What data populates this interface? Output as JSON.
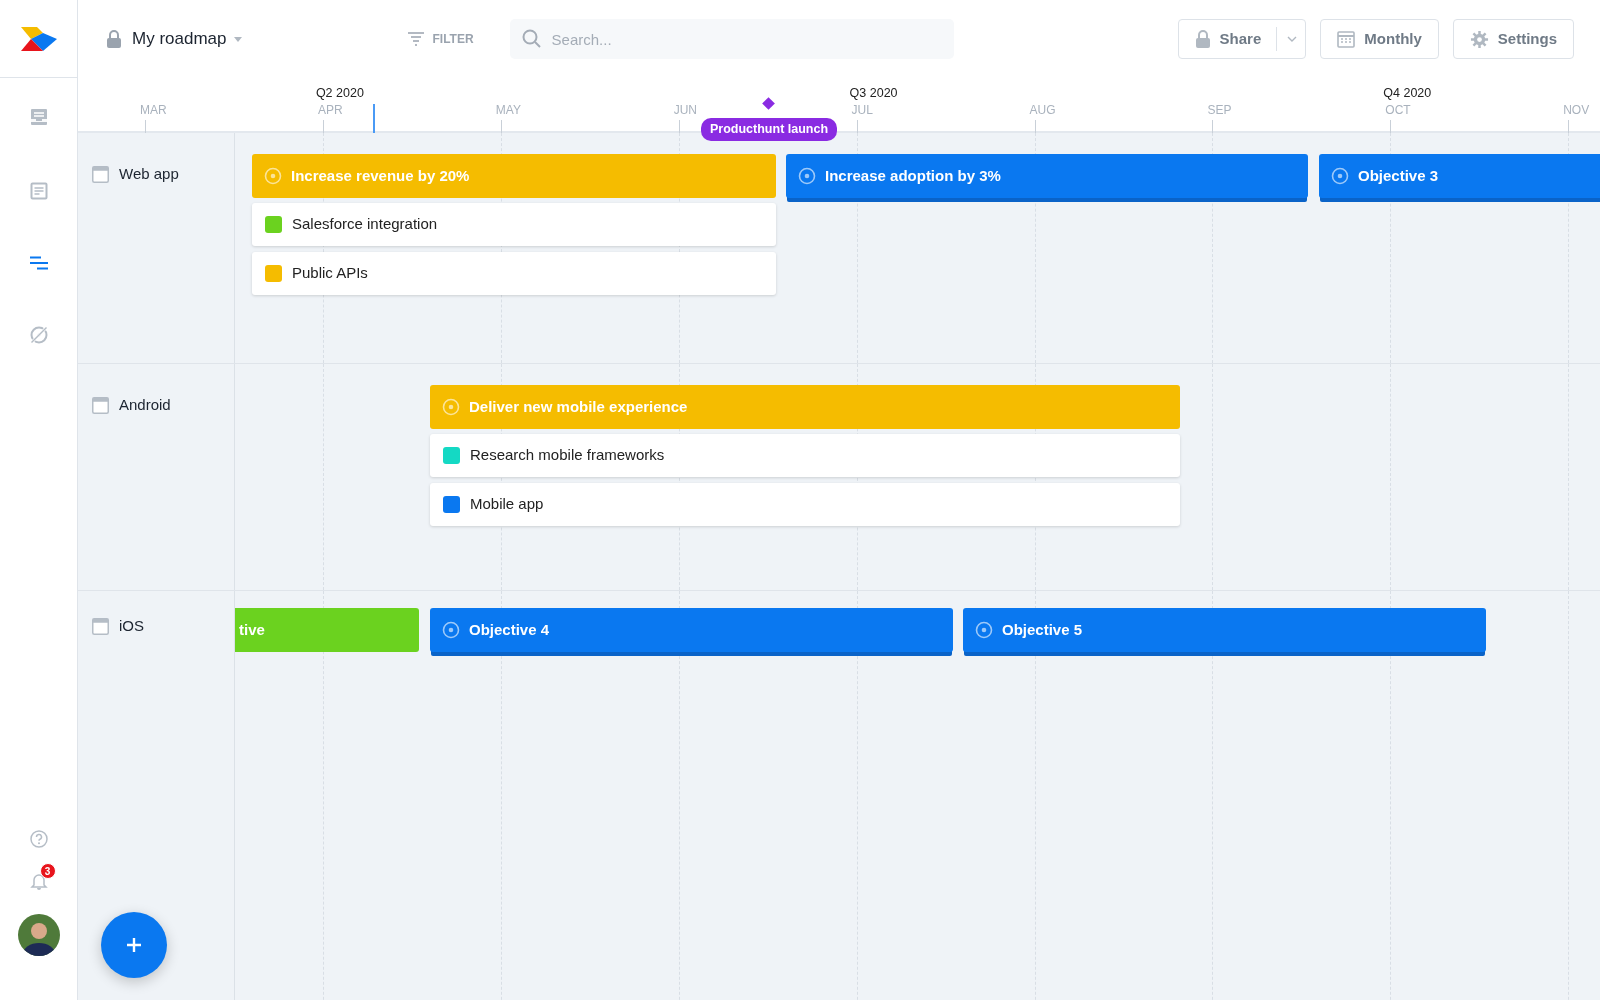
{
  "header": {
    "title": "My roadmap",
    "filter": "FILTER",
    "search": {
      "placeholder": "Search..."
    },
    "buttons": [
      {
        "kind": "share",
        "label": "Share"
      },
      {
        "kind": "monthly",
        "label": "Monthly"
      },
      {
        "kind": "settings",
        "label": "Settings"
      }
    ]
  },
  "sidebar": {
    "items": [
      {
        "kind": "inbox",
        "selected": false
      },
      {
        "kind": "document",
        "selected": false
      },
      {
        "kind": "roadmap",
        "selected": true
      },
      {
        "kind": "hidden",
        "selected": false
      }
    ],
    "notifications": {
      "badge": "3"
    }
  },
  "timeline": {
    "quarters": [
      "Q2 2020",
      "Q3 2020",
      "Q4 2020"
    ],
    "months": [
      "MAR",
      "APR",
      "MAY",
      "JUN",
      "JUL",
      "AUG",
      "SEP",
      "OCT",
      "NOV"
    ],
    "milestone": {
      "label": "Producthunt launch"
    }
  },
  "lanes": [
    {
      "name": "Web app",
      "objectives": [
        {
          "kind": "objective",
          "title": "Increase revenue by 20%",
          "color": "#f5bc00",
          "features": [
            {
              "title": "Salesforce integration",
              "color": "#6bd21f"
            },
            {
              "title": "Public APIs",
              "color": "#f5bc00"
            }
          ]
        },
        {
          "kind": "objective",
          "title": "Increase adoption by 3%",
          "color": "#0a78f0"
        },
        {
          "kind": "objective",
          "title": "Objective 3",
          "color": "#0a78f0"
        }
      ]
    },
    {
      "name": "Android",
      "objectives": [
        {
          "kind": "objective",
          "title": "Deliver new mobile experience",
          "color": "#f5bc00",
          "features": [
            {
              "title": "Research mobile frameworks",
              "color": "#14d9c4"
            },
            {
              "title": "Mobile app",
              "color": "#0a78f0"
            }
          ]
        }
      ]
    },
    {
      "name": "iOS",
      "objectives": [
        {
          "kind": "completed",
          "title": "tive",
          "color": "#6bd21f"
        },
        {
          "kind": "objective",
          "title": "Objective 4",
          "color": "#0a78f0"
        },
        {
          "kind": "objective",
          "title": "Objective 5",
          "color": "#0a78f0"
        }
      ]
    }
  ]
}
